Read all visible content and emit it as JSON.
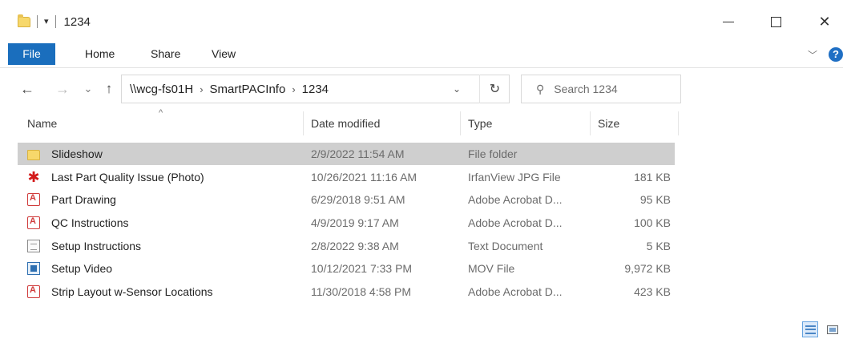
{
  "window": {
    "title": "1234",
    "quick_access_dropdown": "▾",
    "minimize_label": "—",
    "maximize_label": "☐",
    "close_label": "✕"
  },
  "ribbon": {
    "tabs": [
      {
        "label": "File"
      },
      {
        "label": "Home"
      },
      {
        "label": "Share"
      },
      {
        "label": "View"
      }
    ],
    "expand_chevron": "﹀",
    "help": "?"
  },
  "nav": {
    "back": "←",
    "forward": "→",
    "recent": "⌄",
    "up": "↑",
    "address": {
      "crumbs": [
        "\\\\wcg-fs01H",
        "SmartPACInfo",
        "1234"
      ],
      "separator": "›"
    },
    "address_dropdown": "⌄",
    "refresh": "↻",
    "search_placeholder": "Search 1234"
  },
  "columns": {
    "name": "Name",
    "date": "Date modified",
    "type": "Type",
    "size": "Size"
  },
  "files": [
    {
      "name": "Slideshow",
      "date": "2/9/2022 11:54 AM",
      "type": "File folder",
      "size": "",
      "icon": "folder-icon",
      "selected": true
    },
    {
      "name": "Last Part Quality Issue (Photo)",
      "date": "10/26/2021 11:16 AM",
      "type": "IrfanView JPG File",
      "size": "181 KB",
      "icon": "jpg-icon"
    },
    {
      "name": "Part Drawing",
      "date": "6/29/2018 9:51 AM",
      "type": "Adobe Acrobat D...",
      "size": "95 KB",
      "icon": "pdf-icon"
    },
    {
      "name": "QC Instructions",
      "date": "4/9/2019 9:17 AM",
      "type": "Adobe Acrobat D...",
      "size": "100 KB",
      "icon": "pdf-icon"
    },
    {
      "name": "Setup Instructions",
      "date": "2/8/2022 9:38 AM",
      "type": "Text Document",
      "size": "5 KB",
      "icon": "text-icon"
    },
    {
      "name": "Setup Video",
      "date": "10/12/2021 7:33 PM",
      "type": "MOV File",
      "size": "9,972 KB",
      "icon": "video-icon"
    },
    {
      "name": "Strip Layout w-Sensor Locations",
      "date": "11/30/2018 4:58 PM",
      "type": "Adobe Acrobat D...",
      "size": "423 KB",
      "icon": "pdf-icon"
    }
  ],
  "colors": {
    "file_tab": "#1a6ebd",
    "selected_row": "#cfcfcf",
    "help_icon": "#1f6fc4"
  }
}
